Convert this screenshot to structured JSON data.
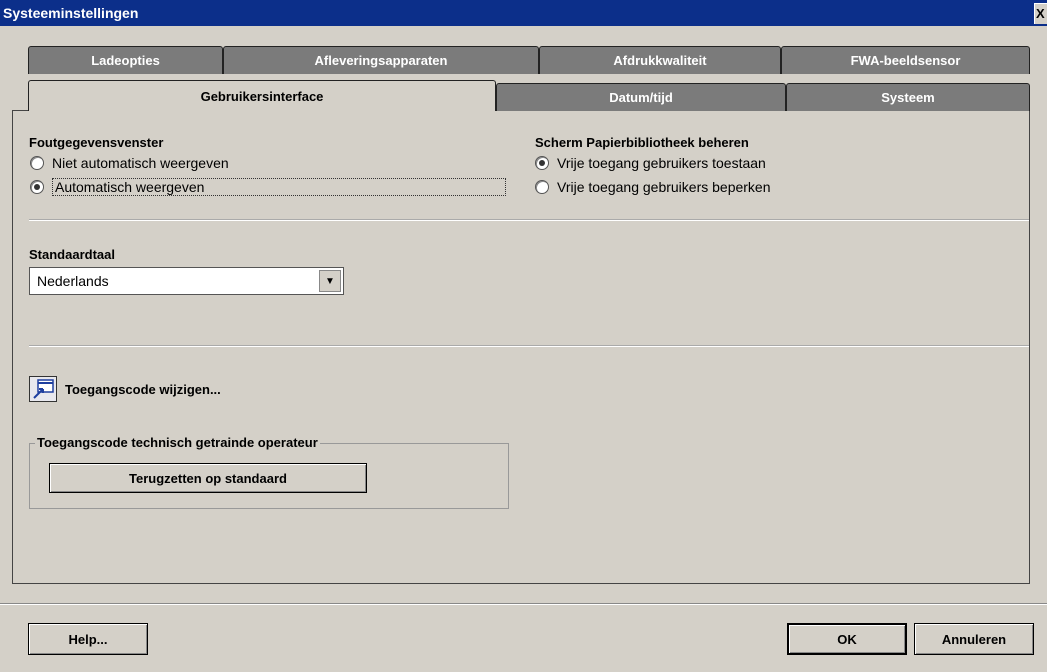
{
  "window": {
    "title": "Systeeminstellingen",
    "close_label": "X"
  },
  "tabs": {
    "row1": [
      "Ladeopties",
      "Afleveringsapparaten",
      "Afdrukkwaliteit",
      "FWA-beeldsensor"
    ],
    "row2": [
      "Gebruikersinterface",
      "Datum/tijd",
      "Systeem"
    ],
    "active": "Gebruikersinterface"
  },
  "foutgegevens": {
    "heading": "Foutgegevensvenster",
    "options": [
      {
        "label": "Niet automatisch weergeven",
        "checked": false
      },
      {
        "label": "Automatisch weergeven",
        "checked": true
      }
    ]
  },
  "papierbibliotheek": {
    "heading": "Scherm Papierbibliotheek beheren",
    "options": [
      {
        "label": "Vrije toegang gebruikers toestaan",
        "checked": true
      },
      {
        "label": "Vrije toegang gebruikers beperken",
        "checked": false
      }
    ]
  },
  "standaardtaal": {
    "heading": "Standaardtaal",
    "value": "Nederlands"
  },
  "toegangscode": {
    "label": "Toegangscode wijzigen..."
  },
  "technisch": {
    "group_title": "Toegangscode technisch getrainde operateur",
    "reset_label": "Terugzetten op standaard"
  },
  "footer": {
    "help_label": "Help...",
    "ok_label": "OK",
    "cancel_label": "Annuleren"
  }
}
